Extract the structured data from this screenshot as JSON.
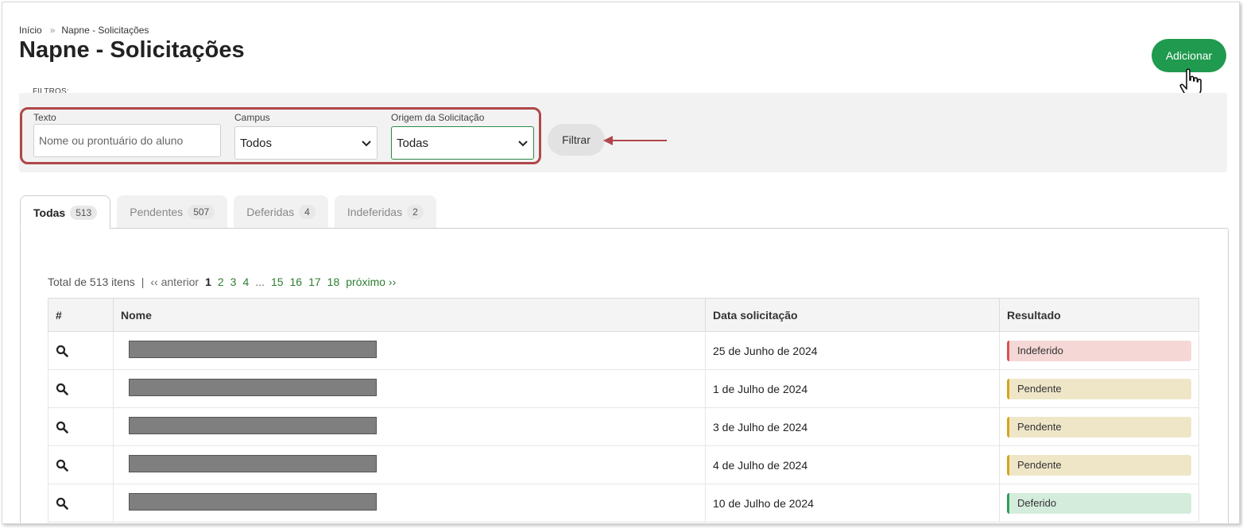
{
  "breadcrumb": {
    "home": "Início",
    "separator": "»",
    "current": "Napne - Solicitações"
  },
  "page": {
    "title": "Napne - Solicitações",
    "add_button": "Adicionar"
  },
  "filters": {
    "section_label": "FILTROS:",
    "text_label": "Texto",
    "text_placeholder": "Nome ou prontuário do aluno",
    "campus_label": "Campus",
    "campus_value": "Todos",
    "origin_label": "Origem da Solicitação",
    "origin_value": "Todas",
    "filter_button": "Filtrar"
  },
  "tabs": [
    {
      "label": "Todas",
      "count": "513"
    },
    {
      "label": "Pendentes",
      "count": "507"
    },
    {
      "label": "Deferidas",
      "count": "4"
    },
    {
      "label": "Indeferidas",
      "count": "2"
    }
  ],
  "pager": {
    "total": "Total de 513 itens",
    "divider": "|",
    "prev": "‹‹ anterior",
    "pages": [
      "1",
      "2",
      "3",
      "4",
      "...",
      "15",
      "16",
      "17",
      "18"
    ],
    "next": "próximo ››"
  },
  "table": {
    "headers": [
      "#",
      "Nome",
      "Data solicitação",
      "Resultado"
    ],
    "rows": [
      {
        "date": "25 de Junho de 2024",
        "result": "Indeferido",
        "status": "indeferido"
      },
      {
        "date": "1 de Julho de 2024",
        "result": "Pendente",
        "status": "pendente"
      },
      {
        "date": "3 de Julho de 2024",
        "result": "Pendente",
        "status": "pendente"
      },
      {
        "date": "4 de Julho de 2024",
        "result": "Pendente",
        "status": "pendente"
      },
      {
        "date": "10 de Julho de 2024",
        "result": "Deferido",
        "status": "deferido"
      }
    ]
  },
  "colors": {
    "accent_green": "#1f9a4e",
    "highlight_red": "#b0474a",
    "status_indeferido": "#d9534f",
    "status_pendente": "#d4a61a",
    "status_deferido": "#2e9e57"
  },
  "icons": {
    "row_action": "search-icon",
    "cursor": "hand-pointer-icon",
    "select_arrow": "chevron-down-icon"
  }
}
